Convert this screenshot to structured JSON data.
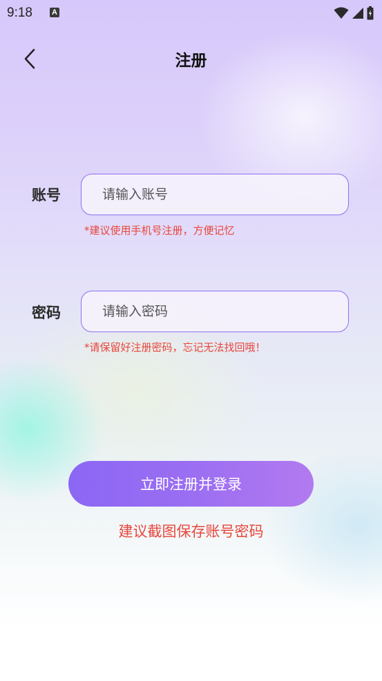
{
  "status_bar": {
    "time": "9:18",
    "notification_icon": "A"
  },
  "header": {
    "title": "注册"
  },
  "form": {
    "account": {
      "label": "账号",
      "placeholder": "请输入账号",
      "value": "",
      "hint": "*建议使用手机号注册，方便记忆"
    },
    "password": {
      "label": "密码",
      "placeholder": "请输入密码",
      "value": "",
      "hint": "*请保留好注册密码，忘记无法找回哦！"
    },
    "submit_label": "立即注册并登录",
    "tip": "建议截图保存账号密码"
  },
  "colors": {
    "accent": "#8f6ff0",
    "warning": "#e8463c"
  }
}
